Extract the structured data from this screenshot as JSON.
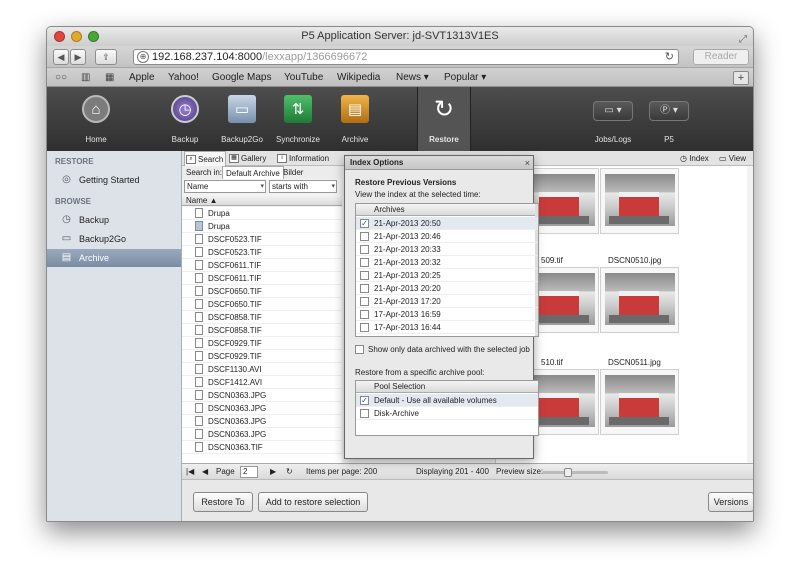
{
  "window": {
    "title": "P5 Application Server: jd-SVT1313V1ES",
    "url_host": "192.168.237.104:8000",
    "url_path": "/lexxapp/1366696672",
    "reader_label": "Reader"
  },
  "bookmarks": [
    "Apple",
    "Yahoo!",
    "Google Maps",
    "YouTube",
    "Wikipedia",
    "News ▾",
    "Popular ▾"
  ],
  "nav": {
    "home": "Home",
    "backup": "Backup",
    "backup2go": "Backup2Go",
    "synchronize": "Synchronize",
    "archive": "Archive",
    "restore": "Restore",
    "jobs_logs": "Jobs/Logs",
    "p5": "P5"
  },
  "sidebar": {
    "restore_header": "RESTORE",
    "getting_started": "Getting Started",
    "browse_header": "BROWSE",
    "backup": "Backup",
    "backup2go": "Backup2Go",
    "archive": "Archive"
  },
  "tabs": {
    "search": "Search",
    "gallery": "Gallery",
    "information": "Information",
    "index": "Index",
    "view": "View"
  },
  "search": {
    "search_in_label": "Search in:",
    "default_archive": "Default Archive",
    "bilder": "Bilder",
    "field": "Name",
    "operator": "starts with",
    "column_name": "Name ▲"
  },
  "files": [
    {
      "name": "Drupa",
      "folder": false
    },
    {
      "name": "Drupa",
      "folder": true
    },
    {
      "name": "DSCF0523.TIF",
      "folder": false
    },
    {
      "name": "DSCF0523.TIF",
      "folder": false
    },
    {
      "name": "DSCF0611.TIF",
      "folder": false
    },
    {
      "name": "DSCF0611.TIF",
      "folder": false
    },
    {
      "name": "DSCF0650.TIF",
      "folder": false
    },
    {
      "name": "DSCF0650.TIF",
      "folder": false
    },
    {
      "name": "DSCF0858.TIF",
      "folder": false
    },
    {
      "name": "DSCF0858.TIF",
      "folder": false
    },
    {
      "name": "DSCF0929.TIF",
      "folder": false
    },
    {
      "name": "DSCF0929.TIF",
      "folder": false
    },
    {
      "name": "DSCF1130.AVI",
      "folder": false
    },
    {
      "name": "DSCF1412.AVI",
      "folder": false
    },
    {
      "name": "DSCN0363.JPG",
      "folder": false
    },
    {
      "name": "DSCN0363.JPG",
      "folder": false
    },
    {
      "name": "DSCN0363.JPG",
      "folder": false
    },
    {
      "name": "DSCN0363.JPG",
      "folder": false
    },
    {
      "name": "DSCN0363.TIF",
      "folder": false
    }
  ],
  "pager": {
    "page_label": "Page",
    "page_value": "2",
    "items_per_page": "Items per page: 200",
    "displaying": "Displaying 201 - 400",
    "preview_size": "Preview size:"
  },
  "gallery": {
    "captions": [
      "509.tif",
      "DSCN0510.jpg",
      "510.tif",
      "DSCN0511.jpg"
    ]
  },
  "dialog": {
    "title": "Index Options",
    "section1": "Restore Previous Versions",
    "view_label": "View the index at the selected time:",
    "archives_header": "Archives",
    "archives": [
      {
        "label": "21-Apr-2013 20:50",
        "checked": true
      },
      {
        "label": "21-Apr-2013 20:46",
        "checked": false
      },
      {
        "label": "21-Apr-2013 20:33",
        "checked": false
      },
      {
        "label": "21-Apr-2013 20:32",
        "checked": false
      },
      {
        "label": "21-Apr-2013 20:25",
        "checked": false
      },
      {
        "label": "21-Apr-2013 20:20",
        "checked": false
      },
      {
        "label": "21-Apr-2013 17:20",
        "checked": false
      },
      {
        "label": "17-Apr-2013 16:59",
        "checked": false
      },
      {
        "label": "17-Apr-2013 16:44",
        "checked": false
      }
    ],
    "only_data_label": "Show only data archived with the selected job",
    "pool_label": "Restore from a specific archive pool:",
    "pool_header": "Pool Selection",
    "pools": [
      {
        "label": "Default - Use all available volumes",
        "checked": true
      },
      {
        "label": "Disk-Archive",
        "checked": false
      }
    ]
  },
  "buttons": {
    "restore_to": "Restore To",
    "add_to_restore": "Add to restore selection",
    "versions": "Versions"
  }
}
